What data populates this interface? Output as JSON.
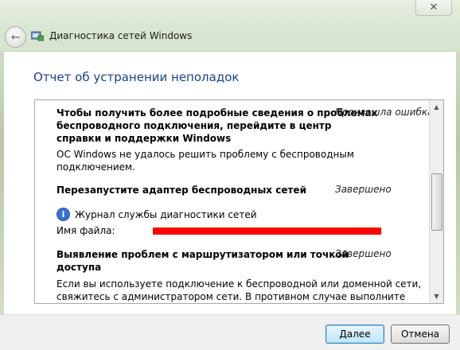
{
  "window": {
    "title": "Диагностика сетей Windows",
    "close_symbol": "✕"
  },
  "heading": "Отчет об устранении неполадок",
  "report": {
    "items": [
      {
        "title_lines": [
          "Чтобы получить более подробные сведения о проблемах",
          "беспроводного подключения, перейдите в центр",
          "справки и поддержки Windows"
        ],
        "status": "Произошла ошибка",
        "detail_lines": [
          "ОС Windows не удалось решить проблему с беспроводным",
          "подключением."
        ]
      },
      {
        "title_lines": [
          "Перезапустите адаптер беспроводных сетей"
        ],
        "status": "Завершено",
        "log_label": "Журнал службы диагностики сетей",
        "file_label": "Имя файла:"
      },
      {
        "title_lines": [
          "Выявление проблем с маршрутизатором или точкой",
          "доступа"
        ],
        "status": "Завершено",
        "detail_lines": [
          "Если вы используете подключение к беспроводной или доменной сети,",
          "свяжитесь с администратором сети. В противном случае выполните"
        ]
      }
    ]
  },
  "buttons": {
    "next": "Далее",
    "cancel": "Отмена"
  },
  "icons": {
    "back": "arrow-left-icon",
    "app": "network-diagnostics-icon",
    "info": "info-icon"
  }
}
